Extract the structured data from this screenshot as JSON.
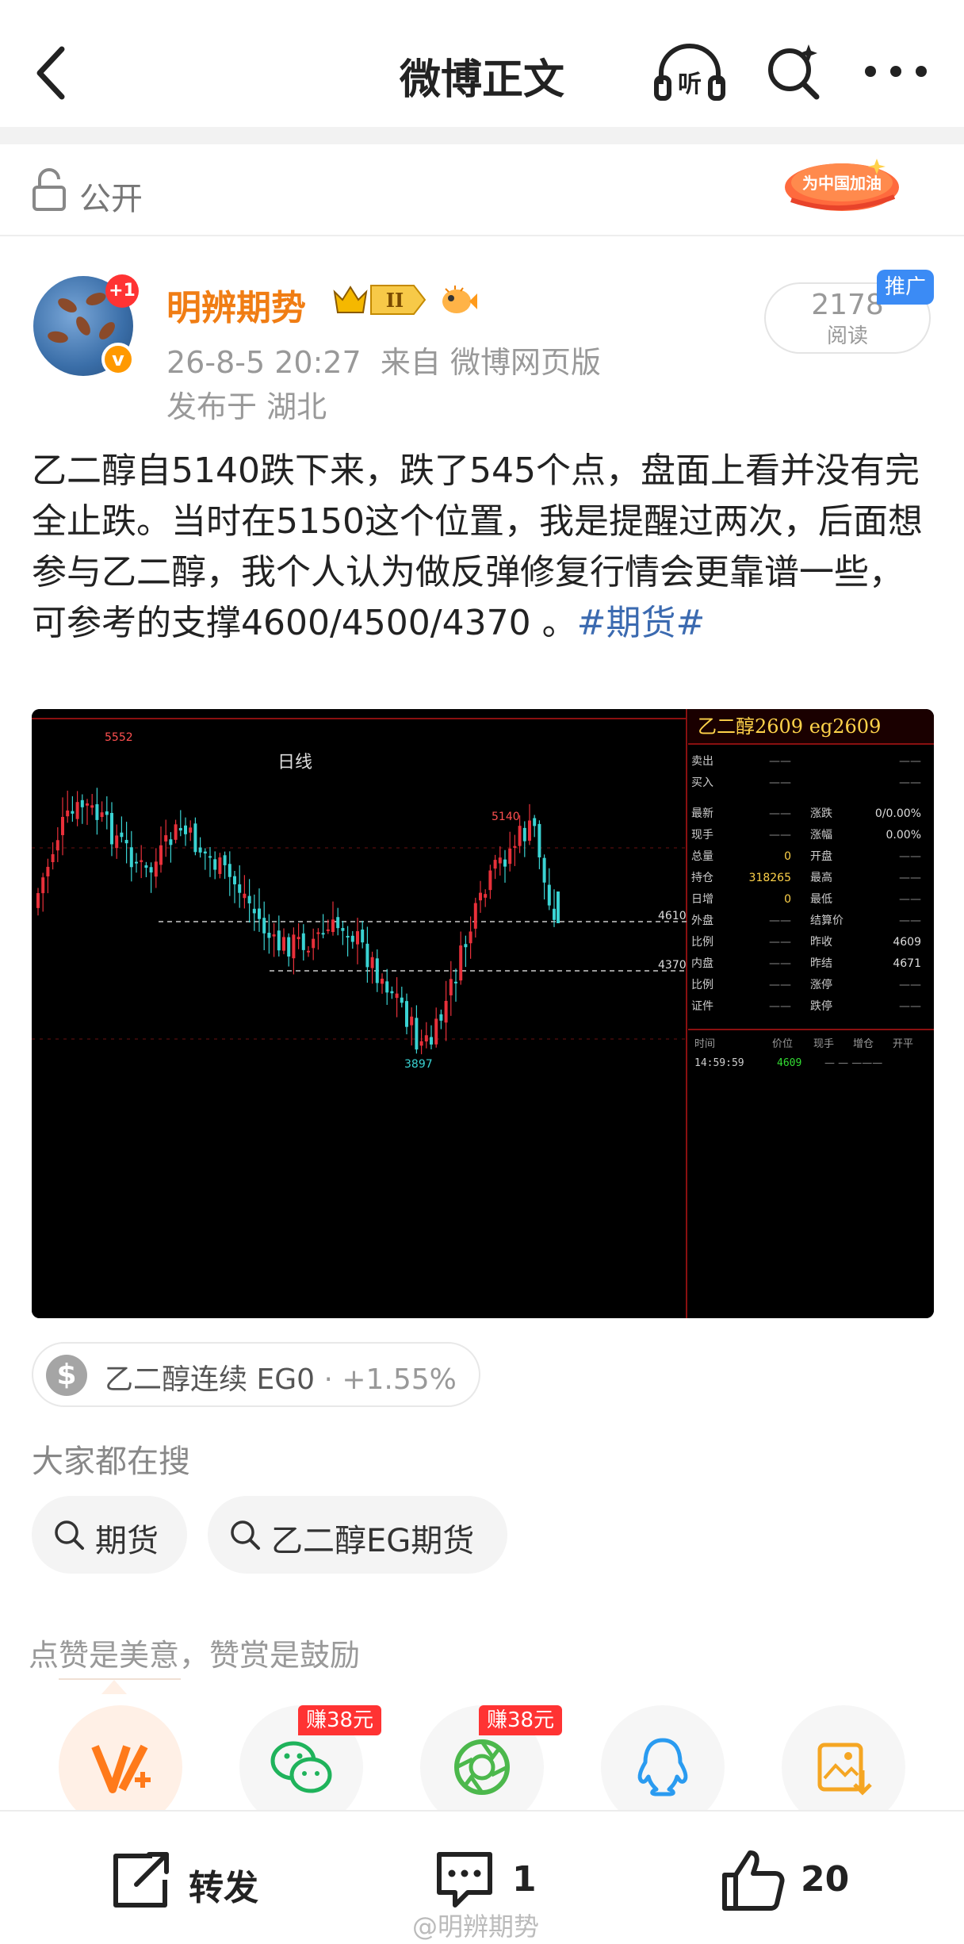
{
  "header": {
    "title": "微博正文"
  },
  "visibility": {
    "label": "公开",
    "badge_text": "为中国加油"
  },
  "author": {
    "name": "明辨期势",
    "notification_badge": "+1",
    "verified_mark": "v",
    "level_badge": "II",
    "timestamp": "26-8-5 20:27",
    "source": "来自 微博网页版",
    "location": "发布于 湖北",
    "read_count": "2178",
    "read_label": "阅读",
    "promo_badge": "推广"
  },
  "post": {
    "text": "乙二醇自5140跌下来，跌了545个点，盘面上看并没有完全止跌。当时在5150这个位置，我是提醒过两次，后面想参与乙二醇，我个人认为做反弹修复行情会更靠谱一些，可参考的支撑4600/4500/4370 。",
    "hashtag": "#期货#"
  },
  "chart_image": {
    "period_label": "日线",
    "high_label": "5552",
    "peak_label": "5140",
    "low_label": "3897",
    "support_label_1": "4610",
    "support_label_2": "4370",
    "panel": {
      "title": "乙二醇2609  eg2609",
      "rows": [
        {
          "l1": "卖出",
          "v1": "——",
          "l2": "",
          "v2": "——"
        },
        {
          "l1": "买入",
          "v1": "——",
          "l2": "",
          "v2": "——"
        },
        {
          "l1": "最新",
          "v1": "——",
          "l2": "涨跌",
          "v2": "0/0.00%"
        },
        {
          "l1": "现手",
          "v1": "——",
          "l2": "涨幅",
          "v2": "0.00%"
        },
        {
          "l1": "总量",
          "v1": "0",
          "l2": "开盘",
          "v2": "——"
        },
        {
          "l1": "持仓",
          "v1": "318265",
          "l2": "最高",
          "v2": "——"
        },
        {
          "l1": "日增",
          "v1": "0",
          "l2": "最低",
          "v2": "——"
        },
        {
          "l1": "外盘",
          "v1": "——",
          "l2": "结算价",
          "v2": "——"
        },
        {
          "l1": "比例",
          "v1": "——",
          "l2": "昨收",
          "v2": "4609"
        },
        {
          "l1": "内盘",
          "v1": "——",
          "l2": "昨结",
          "v2": "4671"
        },
        {
          "l1": "比例",
          "v1": "——",
          "l2": "涨停",
          "v2": "——"
        },
        {
          "l1": "证件",
          "v1": "——",
          "l2": "跌停",
          "v2": "——"
        }
      ],
      "tick_headers": [
        "时间",
        "价位",
        "现手",
        "增仓",
        "开平"
      ],
      "tick_time": "14:59:59",
      "tick_price": "4609"
    }
  },
  "stock_chip": {
    "symbol": "$",
    "name": "乙二醇连续 EG0",
    "separator": "·",
    "change": "+1.55%",
    "change_color": "#999999"
  },
  "hot_search": {
    "title": "大家都在搜",
    "items": [
      "期货",
      "乙二醇EG期货"
    ]
  },
  "reward": {
    "title": "点赞是美意，赞赏是鼓励",
    "earn_label_1": "赚38元",
    "earn_label_2": "赚38元",
    "share_icons": [
      "reward-v-icon",
      "wechat-icon",
      "moments-icon",
      "qq-icon",
      "save-image-icon"
    ]
  },
  "actions": {
    "repost_label": "转发",
    "comment_count": "1",
    "like_count": "20"
  },
  "watermark": "@明辨期势",
  "colors": {
    "accent_orange": "#f07d14",
    "link_blue": "#3b6ab0",
    "up_red": "#e8303a",
    "down_cyan": "#3ad3d3",
    "promo_blue": "#3b8bf5"
  }
}
